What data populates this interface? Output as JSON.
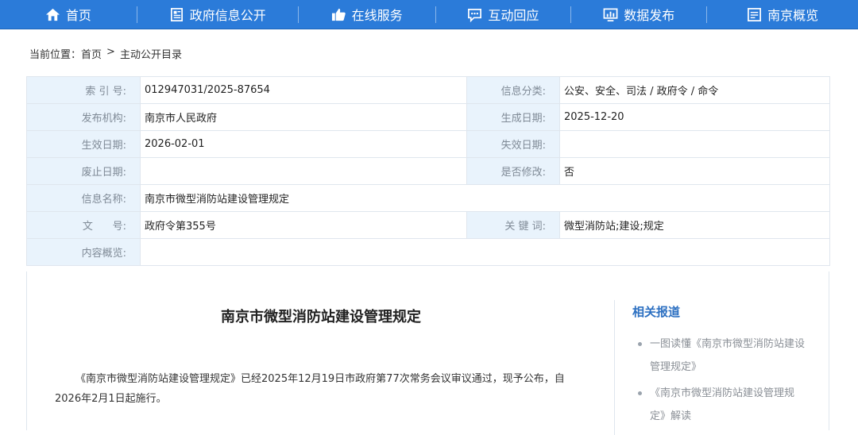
{
  "nav": {
    "items": [
      {
        "label": "首页",
        "icon": "home-icon"
      },
      {
        "label": "政府信息公开",
        "icon": "document-icon"
      },
      {
        "label": "在线服务",
        "icon": "thumbs-up-icon"
      },
      {
        "label": "互动回应",
        "icon": "chat-icon"
      },
      {
        "label": "数据发布",
        "icon": "chart-icon"
      },
      {
        "label": "南京概览",
        "icon": "overview-icon"
      }
    ]
  },
  "breadcrumb": {
    "prefix": "当前位置：",
    "home": "首页",
    "sep": ">",
    "current": "主动公开目录"
  },
  "meta": {
    "index_label": "索 引 号:",
    "index_value": "012947031/2025-87654",
    "category_label": "信息分类:",
    "category_value": "公安、安全、司法 / 政府令 / 命令",
    "publisher_label": "发布机构:",
    "publisher_value": "南京市人民政府",
    "created_label": "生成日期:",
    "created_value": "2025-12-20",
    "effective_label": "生效日期:",
    "effective_value": "2026-02-01",
    "expire_label": "失效日期:",
    "expire_value": "",
    "abolish_label": "废止日期:",
    "abolish_value": "",
    "modified_label": "是否修改:",
    "modified_value": "否",
    "name_label": "信息名称:",
    "name_value": "南京市微型消防站建设管理规定",
    "docno_label": "文      号:",
    "docno_value": "政府令第355号",
    "keywords_label": "关 键 词:",
    "keywords_value": "微型消防站;建设;规定",
    "summary_label": "内容概览:",
    "summary_value": ""
  },
  "document": {
    "title": "南京市微型消防站建设管理规定",
    "body": "《南京市微型消防站建设管理规定》已经2025年12月19日市政府第77次常务会议审议通过，现予公布，自2026年2月1日起施行。"
  },
  "related": {
    "title": "相关报道",
    "items": [
      "一图读懂《南京市微型消防站建设管理规定》",
      "《南京市微型消防站建设管理规定》解读"
    ]
  },
  "colors": {
    "nav_bg": "#2b7bd9",
    "label_bg": "#e9f3fc",
    "accent": "#2b6fc1"
  }
}
